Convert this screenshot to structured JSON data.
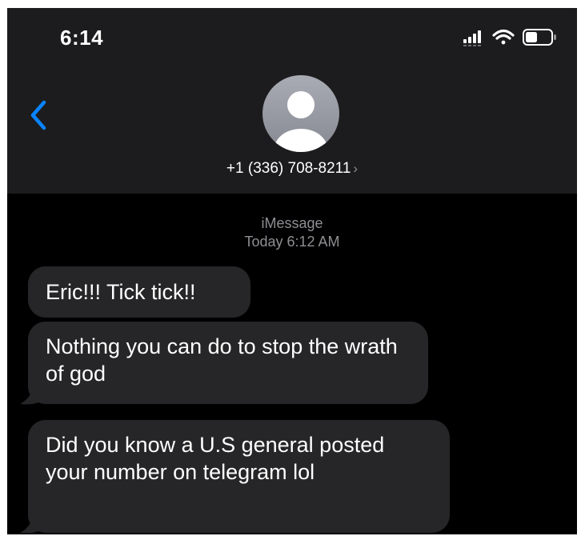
{
  "status_bar": {
    "time": "6:14",
    "icons": [
      "cellular-signal-icon",
      "wifi-icon",
      "battery-icon"
    ]
  },
  "header": {
    "back_icon": "chevron-left-icon",
    "avatar_icon": "person-icon",
    "contact_name": "+1 (336) 708-8211",
    "contact_chevron": "›"
  },
  "conversation": {
    "service": "iMessage",
    "timestamp": "Today 6:12 AM",
    "messages": [
      {
        "direction": "incoming",
        "text": "Eric!!! Tick tick!!"
      },
      {
        "direction": "incoming",
        "text": "Nothing you can do to stop the wrath of god"
      },
      {
        "direction": "incoming",
        "text": "Did you know a U.S general posted your number on telegram lol"
      }
    ]
  },
  "colors": {
    "header_bg": "#1c1c1e",
    "screen_bg": "#000000",
    "bubble_incoming": "#262628",
    "accent_blue": "#0a84ff",
    "secondary_text": "#8e8e93"
  }
}
